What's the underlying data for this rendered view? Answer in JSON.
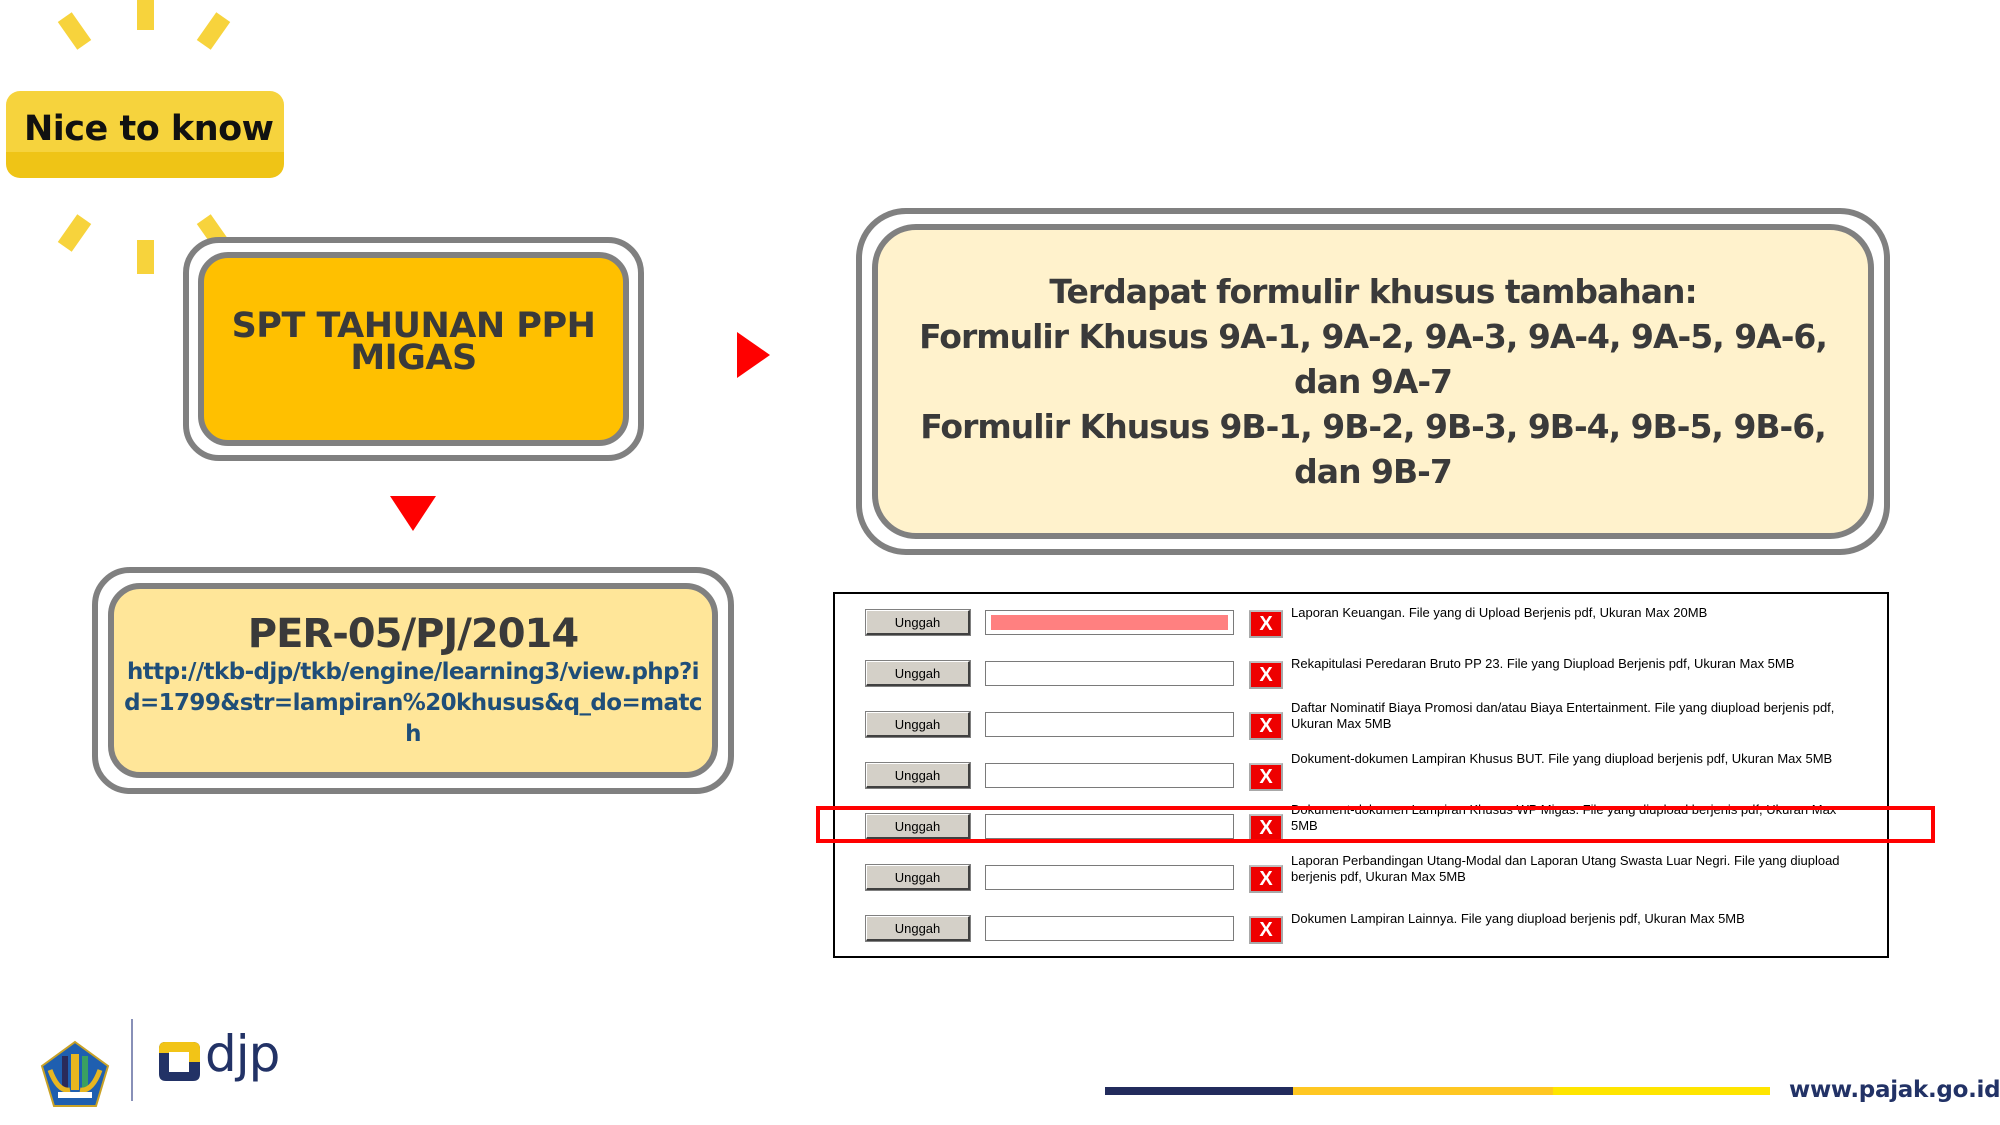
{
  "badge": {
    "label": "Nice to know",
    "icon": "sun-rays-icon"
  },
  "flow": {
    "source": {
      "lines": [
        "SPT TAHUNAN PPH",
        "MIGAS"
      ]
    },
    "regulation": {
      "title": "PER-05/PJ/2014",
      "link": "http://tkb-djp/tkb/engine/learning3/view.php?id=1799&str=lampiran%20khusus&q_do=match"
    },
    "info": {
      "lines": [
        "Terdapat formulir khusus tambahan:",
        "Formulir Khusus 9A-1, 9A-2, 9A-3, 9A-4, 9A-5, 9A-6,",
        "dan 9A-7",
        "Formulir Khusus 9B-1, 9B-2, 9B-3, 9B-4, 9B-5, 9B-6,",
        "dan 9B-7"
      ]
    },
    "arrow_color": "#ff0000"
  },
  "upload_panel": {
    "button_label": "Unggah",
    "delete_label": "X",
    "highlighted_row": 4,
    "rows": [
      {
        "description": "Laporan Keuangan. File yang di Upload Berjenis pdf, Ukuran Max 20MB",
        "file_value": "",
        "error": true
      },
      {
        "description": "Rekapitulasi Peredaran Bruto PP 23. File yang Diupload Berjenis pdf, Ukuran Max 5MB",
        "file_value": "",
        "error": false
      },
      {
        "description": "Daftar Nominatif Biaya Promosi dan/atau Biaya Entertainment. File yang diupload berjenis pdf, Ukuran Max 5MB",
        "file_value": "",
        "error": false
      },
      {
        "description": "Dokument-dokumen Lampiran Khusus BUT. File yang diupload berjenis pdf, Ukuran Max 5MB",
        "file_value": "",
        "error": false
      },
      {
        "description": "Dokument-dokumen Lampiran Khusus WP Migas. File yang diupload berjenis pdf, Ukuran Max 5MB",
        "file_value": "",
        "error": false
      },
      {
        "description": "Laporan Perbandingan Utang-Modal dan Laporan Utang Swasta Luar Negri. File yang diupload berjenis pdf, Ukuran Max 5MB",
        "file_value": "",
        "error": false
      },
      {
        "description": "Dokumen Lampiran Lainnya. File yang diupload berjenis pdf, Ukuran Max 5MB",
        "file_value": "",
        "error": false
      }
    ]
  },
  "footer": {
    "logo_text": "djp",
    "website": "www.pajak.go.id",
    "colors": {
      "navy": "#222b5c",
      "orange": "#ffc722",
      "yellow": "#ffe500"
    }
  }
}
